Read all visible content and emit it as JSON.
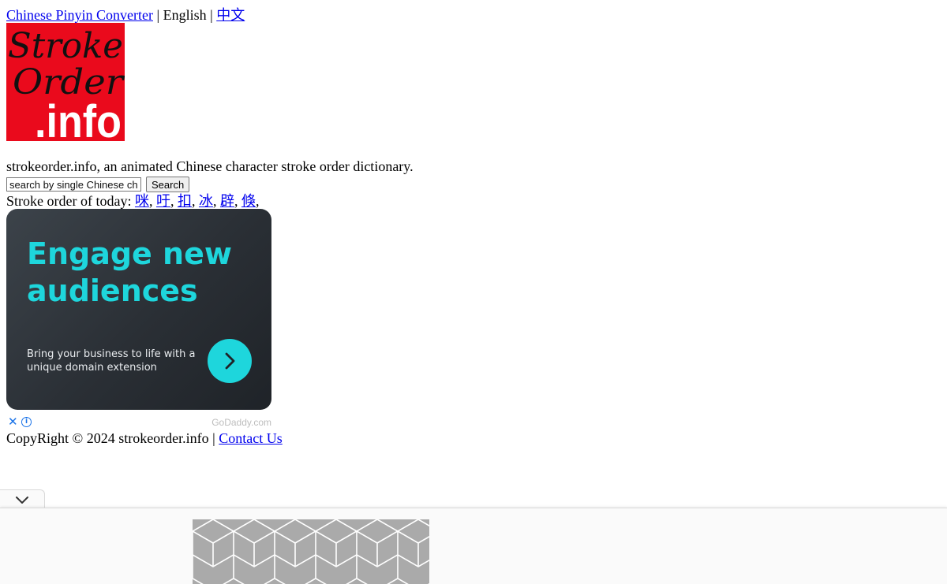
{
  "nav": {
    "converter_link": "Chinese Pinyin Converter",
    "separator": "|",
    "current_language": "English",
    "chinese_link": "中文"
  },
  "logo": {
    "line1": "Stroke",
    "line2": "Order",
    "line3": ".info",
    "background_color": "#ea0a1c"
  },
  "tagline": "strokeorder.info, an animated Chinese character stroke order dictionary.",
  "search": {
    "placeholder": "search by single Chinese character",
    "button_label": "Search"
  },
  "today": {
    "label": "Stroke order of today:",
    "characters": [
      "咪",
      "吁",
      "扣",
      "冰",
      "辟",
      "倏"
    ],
    "separator": ","
  },
  "ad": {
    "headline": "Engage new audiences",
    "body": "Bring your business to life with a unique domain extension",
    "cta_icon": "chevron-right-icon",
    "close_icon": "close-icon",
    "info_icon": "info-icon",
    "brand": "GoDaddy.com",
    "accent_color": "#1ed6dc"
  },
  "footer": {
    "copyright": "CopyRight © 2024 strokeorder.info",
    "separator": "|",
    "contact_link": "Contact Us"
  },
  "bottom_bar": {
    "collapse_icon": "chevron-down-icon"
  }
}
